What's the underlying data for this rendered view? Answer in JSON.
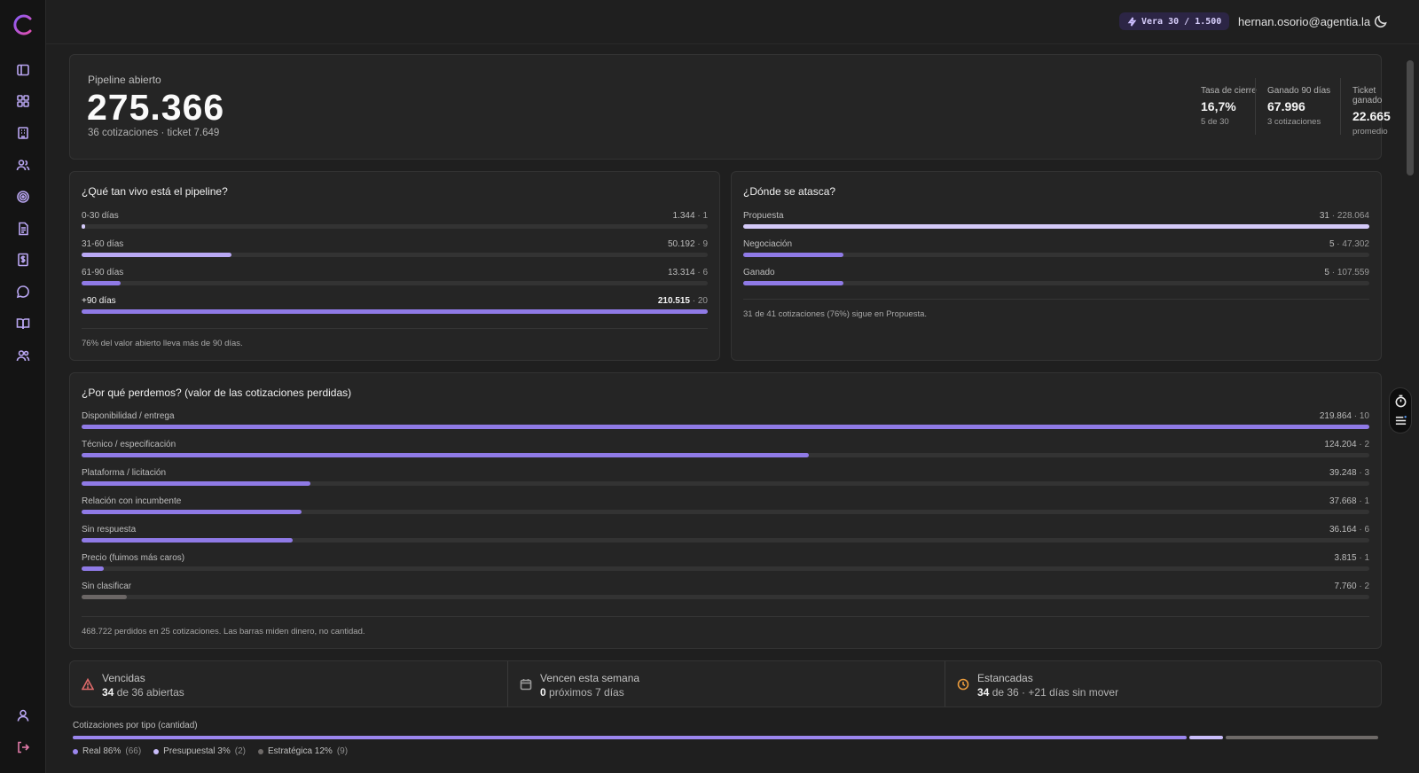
{
  "topbar": {
    "credit_label": "Vera 30 / 1.500",
    "user_email": "hernan.osorio@agentia.la"
  },
  "sidebar": {
    "items": [
      {
        "icon": "panel-icon"
      },
      {
        "icon": "dashboard-icon"
      },
      {
        "icon": "building-icon"
      },
      {
        "icon": "users-icon"
      },
      {
        "icon": "target-icon"
      },
      {
        "icon": "document-icon"
      },
      {
        "icon": "dollar-icon"
      },
      {
        "icon": "chat-icon"
      },
      {
        "icon": "book-icon"
      },
      {
        "icon": "team-icon"
      }
    ],
    "bottom": [
      {
        "icon": "user-icon"
      },
      {
        "icon": "logout-icon"
      }
    ]
  },
  "pipeline": {
    "label": "Pipeline abierto",
    "value": "275.366",
    "sub": "36 cotizaciones · ticket 7.649",
    "kpis": [
      {
        "label": "Tasa de cierre",
        "value": "16,7%",
        "sub": "5 de 30"
      },
      {
        "label": "Ganado 90 días",
        "value": "67.996",
        "sub": "3 cotizaciones"
      },
      {
        "label": "Ticket ganado",
        "value": "22.665",
        "sub": "promedio"
      }
    ]
  },
  "aging": {
    "title": "¿Qué tan vivo está el pipeline?",
    "rows": [
      {
        "label": "0-30 días",
        "amount": "1.344",
        "count": "1",
        "fraction": 0.006
      },
      {
        "label": "31-60 días",
        "amount": "50.192",
        "count": "9",
        "fraction": 0.24
      },
      {
        "label": "61-90 días",
        "amount": "13.314",
        "count": "6",
        "fraction": 0.063
      },
      {
        "label": "+90 días",
        "amount": "210.515",
        "count": "20",
        "fraction": 1.0
      }
    ],
    "foot": "76% del valor abierto lleva más de 90 días."
  },
  "stages": {
    "title": "¿Dónde se atasca?",
    "rows": [
      {
        "label": "Propuesta",
        "count": "31",
        "amount": "228.064",
        "fraction": 1.0
      },
      {
        "label": "Negociación",
        "count": "5",
        "amount": "47.302",
        "fraction": 0.08
      },
      {
        "label": "Ganado",
        "count": "5",
        "amount": "107.559",
        "fraction": 0.08
      }
    ],
    "foot": "31 de 41 cotizaciones (76%) sigue en Propuesta."
  },
  "losses": {
    "title": "¿Por qué perdemos? (valor de las cotizaciones perdidas)",
    "rows": [
      {
        "label": "Disponibilidad / entrega",
        "amount": "219.864",
        "count": "10",
        "fraction": 1.0
      },
      {
        "label": "Técnico / especificación",
        "amount": "124.204",
        "count": "2",
        "fraction": 0.565
      },
      {
        "label": "Plataforma / licitación",
        "amount": "39.248",
        "count": "3",
        "fraction": 0.178
      },
      {
        "label": "Relación con incumbente",
        "amount": "37.668",
        "count": "1",
        "fraction": 0.171
      },
      {
        "label": "Sin respuesta",
        "amount": "36.164",
        "count": "6",
        "fraction": 0.164
      },
      {
        "label": "Precio (fuimos más caros)",
        "amount": "3.815",
        "count": "1",
        "fraction": 0.017
      },
      {
        "label": "Sin clasificar",
        "amount": "7.760",
        "count": "2",
        "fraction": 0.035
      }
    ],
    "foot": "468.722 perdidos en 25 cotizaciones. Las barras miden dinero, no cantidad."
  },
  "status": [
    {
      "title": "Vencidas",
      "strong": "34",
      "rest": " de 36 abiertas",
      "color": "#e06b6b"
    },
    {
      "title": "Vencen esta semana",
      "strong": "0",
      "rest": " próximos 7 días",
      "color": "#9a9a9a"
    },
    {
      "title": "Estancadas",
      "strong": "34",
      "rest": " de 36 · +21 días sin mover",
      "color": "#e89a3c"
    }
  ],
  "types": {
    "title": "Cotizaciones por tipo (cantidad)",
    "segments": [
      {
        "label": "Real 86%",
        "count": "(66)",
        "fraction": 0.857,
        "color": "#9b86ee"
      },
      {
        "label": "Presupuestal 3%",
        "count": "(2)",
        "fraction": 0.026,
        "color": "#c9bdfa"
      },
      {
        "label": "Estratégica 12%",
        "count": "(9)",
        "fraction": 0.117,
        "color": "#6e6a68"
      }
    ]
  },
  "colors": {
    "accent": "#8f7ae6",
    "accent_light": "#b9a8f4",
    "background": "#1f1f1f",
    "card": "#252525"
  }
}
